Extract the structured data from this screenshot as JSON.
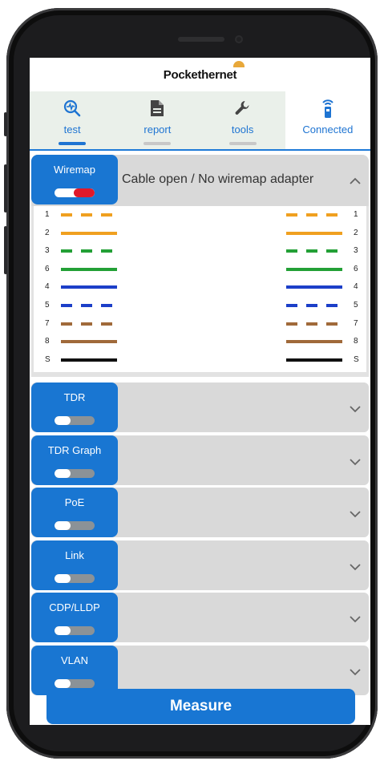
{
  "app": {
    "brand": "Pockethernet"
  },
  "tabs": [
    {
      "label": "test",
      "icon": "test-icon",
      "active": true
    },
    {
      "label": "report",
      "icon": "report-icon",
      "active": false
    },
    {
      "label": "tools",
      "icon": "wrench-icon",
      "active": false
    },
    {
      "label": "Connected",
      "icon": "remote-device-icon",
      "active": false
    }
  ],
  "wiremap": {
    "label": "Wiremap",
    "status": "Cable open / No wiremap adapter",
    "toggle_state": "on",
    "pins": [
      {
        "left": "1",
        "right": "1",
        "color": "#f0a020",
        "style": "dashed"
      },
      {
        "left": "2",
        "right": "2",
        "color": "#f0a020",
        "style": "solid"
      },
      {
        "left": "3",
        "right": "3",
        "color": "#23a036",
        "style": "dashed"
      },
      {
        "left": "6",
        "right": "6",
        "color": "#23a036",
        "style": "solid"
      },
      {
        "left": "4",
        "right": "4",
        "color": "#1c3fc8",
        "style": "solid"
      },
      {
        "left": "5",
        "right": "5",
        "color": "#1c3fc8",
        "style": "dashed"
      },
      {
        "left": "7",
        "right": "7",
        "color": "#a06a3a",
        "style": "dashed"
      },
      {
        "left": "8",
        "right": "8",
        "color": "#a06a3a",
        "style": "solid"
      },
      {
        "left": "S",
        "right": "S",
        "color": "#111111",
        "style": "solid"
      }
    ]
  },
  "sections": [
    {
      "label": "TDR"
    },
    {
      "label": "TDR Graph"
    },
    {
      "label": "PoE"
    },
    {
      "label": "Link"
    },
    {
      "label": "CDP/LLDP"
    },
    {
      "label": "VLAN"
    }
  ],
  "measure_label": "Measure",
  "colors": {
    "accent": "#1976d2",
    "toggle_on": "#e0192a",
    "toggle_off": "#8b9297",
    "panel": "#d9d9d9"
  }
}
